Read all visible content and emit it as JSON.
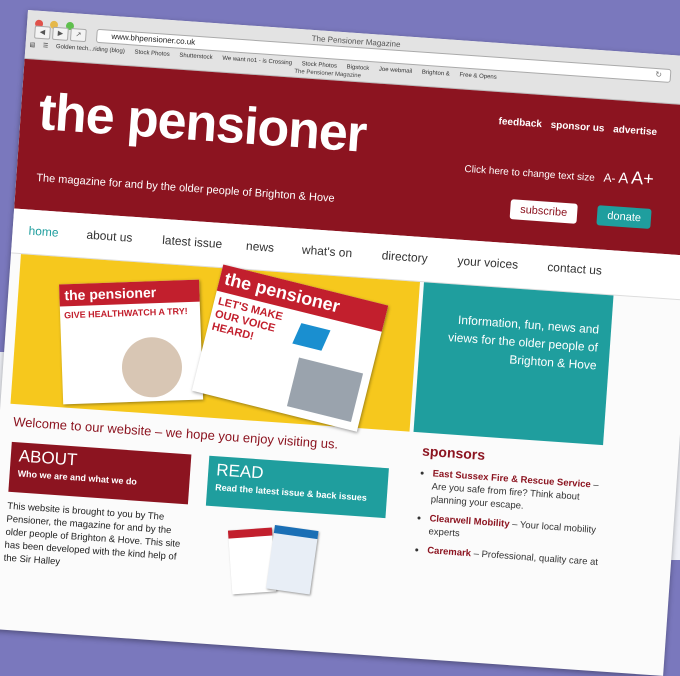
{
  "browser": {
    "window_title": "The Pensioner Magazine",
    "url": "www.bhpensioner.co.uk",
    "tab_title": "The Pensioner Magazine",
    "bookmarks": [
      "Golden tech...riding (blog)",
      "Stock Photos",
      "Shutterstock",
      "We want no1 - is Crossing",
      "Stock Photos",
      "Bigstock",
      "Joe webmail",
      "Brighton &",
      "Free & Opens"
    ]
  },
  "header": {
    "logo": "the pensioner",
    "tagline": "The magazine for and by the older people of Brighton & Hove",
    "links": [
      "feedback",
      "sponsor us",
      "advertise"
    ],
    "textsize_label": "Click here to change text size",
    "textsize_small": "A-",
    "textsize_mid": "A",
    "textsize_big": "A+",
    "subscribe": "subscribe",
    "donate": "donate"
  },
  "nav": [
    "home",
    "about us",
    "latest issue",
    "news",
    "what's on",
    "directory",
    "your voices",
    "contact us"
  ],
  "hero": {
    "cover1_title": "the pensioner",
    "cover1_headline": "GIVE HEALTHWATCH A TRY!",
    "cover2_title": "the pensioner",
    "cover2_headline": "LET'S MAKE OUR VOICE HEARD!",
    "text": "Information, fun, news and views for the older people of Brighton & Hove"
  },
  "welcome": "Welcome to our website – we hope you enjoy visiting us.",
  "about": {
    "title": "ABOUT",
    "subtitle": "Who we are and what we do",
    "text": "This website is brought to you by The Pensioner, the magazine for and by the older people of Brighton & Hove. This site has been developed with the kind help of the Sir Halley"
  },
  "read": {
    "title": "READ",
    "subtitle": "Read the latest issue & back issues"
  },
  "sponsors": {
    "title": "sponsors",
    "items": [
      {
        "name": "East Sussex Fire & Rescue Service",
        "desc": " – Are you safe from fire? Think about planning your escape."
      },
      {
        "name": "Clearwell Mobility",
        "desc": " – Your local mobility experts"
      },
      {
        "name": "Caremark",
        "desc": " – Professional, quality care at"
      }
    ]
  },
  "colors": {
    "brand_red": "#8c1420",
    "teal": "#1f9e9e",
    "yellow": "#f6c81d",
    "backdrop": "#7a78bd"
  }
}
